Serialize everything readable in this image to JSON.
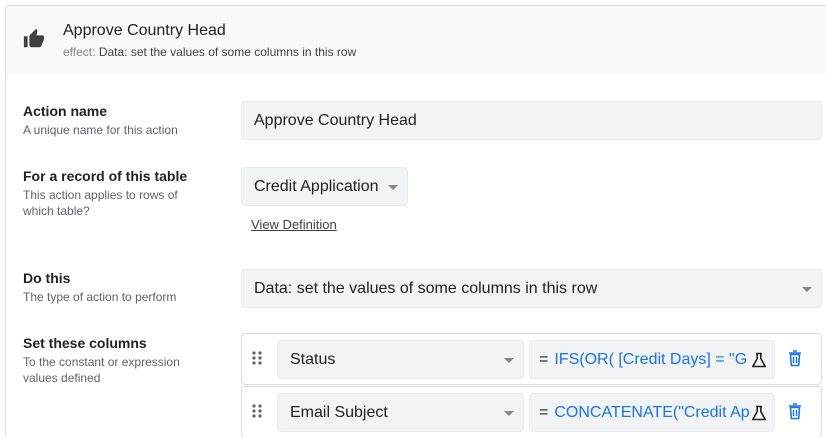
{
  "header": {
    "icon": "thumbs-up-icon",
    "title": "Approve Country Head",
    "subtitle_prefix": "effect:",
    "subtitle": "Data: set the values of some columns in this row"
  },
  "fields": {
    "action_name": {
      "label": "Action name",
      "description": "A unique name for this action",
      "value": "Approve Country Head"
    },
    "table": {
      "label": "For a record of this table",
      "description": "This action applies to rows of which table?",
      "value": "Credit Application",
      "link": "View Definition"
    },
    "do_this": {
      "label": "Do this",
      "description": "The type of action to perform",
      "value": "Data: set the values of some columns in this row"
    },
    "set_columns": {
      "label": "Set these columns",
      "description": "To the constant or expression values defined",
      "rows": [
        {
          "column": "Status",
          "eq": "=",
          "expression": "IFS(OR(  [Credit Days] = \"G"
        },
        {
          "column": "Email Subject",
          "eq": "=",
          "expression": "CONCATENATE(\"Credit Ap"
        }
      ]
    }
  },
  "colors": {
    "accent": "#1a73e8",
    "header_bg": "#f8f9fa",
    "field_bg": "#f1f3f4"
  }
}
